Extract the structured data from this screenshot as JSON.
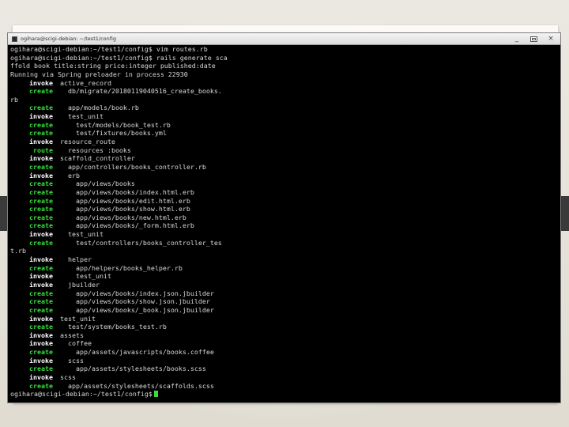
{
  "window": {
    "title": "ogihara@scigi-debian: ~/test1/config",
    "controls": {
      "minimize": "_",
      "close": "×"
    },
    "colors": {
      "terminal_bg": "#000000",
      "create": "#35e03a",
      "invoke": "#ffffff",
      "text": "#d8d8d8"
    }
  },
  "terminal": {
    "lines": [
      {
        "kw": "",
        "text": "ogihara@scigi-debian:~/test1/config$ vim routes.rb",
        "indent": 0,
        "raw": true
      },
      {
        "kw": "",
        "text": "ogihara@scigi-debian:~/test1/config$ rails generate sca",
        "indent": 0,
        "raw": true
      },
      {
        "kw": "",
        "text": "ffold book title:string price:integer published:date",
        "indent": 0,
        "raw": true
      },
      {
        "kw": "",
        "text": "Running via Spring preloader in process 22930",
        "indent": 0,
        "raw": true
      },
      {
        "kw": "invoke",
        "text": "active_record",
        "indent": 0
      },
      {
        "kw": "create",
        "text": "db/migrate/20180119040516_create_books.",
        "indent": 1
      },
      {
        "kw": "",
        "text": "rb",
        "indent": 0,
        "raw": true
      },
      {
        "kw": "create",
        "text": "app/models/book.rb",
        "indent": 1
      },
      {
        "kw": "invoke",
        "text": "test_unit",
        "indent": 1
      },
      {
        "kw": "create",
        "text": "test/models/book_test.rb",
        "indent": 2
      },
      {
        "kw": "create",
        "text": "test/fixtures/books.yml",
        "indent": 2
      },
      {
        "kw": "invoke",
        "text": "resource_route",
        "indent": 0
      },
      {
        "kw": "route",
        "text": "resources :books",
        "indent": 1
      },
      {
        "kw": "invoke",
        "text": "scaffold_controller",
        "indent": 0
      },
      {
        "kw": "create",
        "text": "app/controllers/books_controller.rb",
        "indent": 1
      },
      {
        "kw": "invoke",
        "text": "erb",
        "indent": 1
      },
      {
        "kw": "create",
        "text": "app/views/books",
        "indent": 2
      },
      {
        "kw": "create",
        "text": "app/views/books/index.html.erb",
        "indent": 2
      },
      {
        "kw": "create",
        "text": "app/views/books/edit.html.erb",
        "indent": 2
      },
      {
        "kw": "create",
        "text": "app/views/books/show.html.erb",
        "indent": 2
      },
      {
        "kw": "create",
        "text": "app/views/books/new.html.erb",
        "indent": 2
      },
      {
        "kw": "create",
        "text": "app/views/books/_form.html.erb",
        "indent": 2
      },
      {
        "kw": "invoke",
        "text": "test_unit",
        "indent": 1
      },
      {
        "kw": "create",
        "text": "test/controllers/books_controller_tes",
        "indent": 2
      },
      {
        "kw": "",
        "text": "t.rb",
        "indent": 0,
        "raw": true
      },
      {
        "kw": "invoke",
        "text": "helper",
        "indent": 1
      },
      {
        "kw": "create",
        "text": "app/helpers/books_helper.rb",
        "indent": 2
      },
      {
        "kw": "invoke",
        "text": "test_unit",
        "indent": 2
      },
      {
        "kw": "invoke",
        "text": "jbuilder",
        "indent": 1
      },
      {
        "kw": "create",
        "text": "app/views/books/index.json.jbuilder",
        "indent": 2
      },
      {
        "kw": "create",
        "text": "app/views/books/show.json.jbuilder",
        "indent": 2
      },
      {
        "kw": "create",
        "text": "app/views/books/_book.json.jbuilder",
        "indent": 2
      },
      {
        "kw": "invoke",
        "text": "test_unit",
        "indent": 0
      },
      {
        "kw": "create",
        "text": "test/system/books_test.rb",
        "indent": 1
      },
      {
        "kw": "invoke",
        "text": "assets",
        "indent": 0
      },
      {
        "kw": "invoke",
        "text": "coffee",
        "indent": 1
      },
      {
        "kw": "create",
        "text": "app/assets/javascripts/books.coffee",
        "indent": 2
      },
      {
        "kw": "invoke",
        "text": "scss",
        "indent": 1
      },
      {
        "kw": "create",
        "text": "app/assets/stylesheets/books.scss",
        "indent": 2
      },
      {
        "kw": "invoke",
        "text": "scss",
        "indent": 0
      },
      {
        "kw": "create",
        "text": "app/assets/stylesheets/scaffolds.scss",
        "indent": 1
      },
      {
        "kw": "",
        "text": "ogihara@scigi-debian:~/test1/config$",
        "indent": 0,
        "raw": true,
        "cursor": true
      }
    ]
  }
}
